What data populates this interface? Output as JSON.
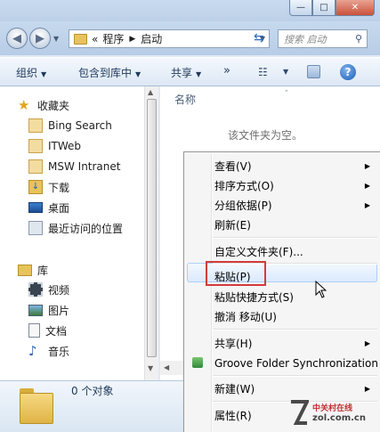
{
  "window": {
    "buttons": [
      "—",
      "□",
      "✕"
    ]
  },
  "address": {
    "prefix": "«",
    "crumbs": [
      "程序",
      "启动"
    ]
  },
  "search": {
    "placeholder": "搜索 启动"
  },
  "toolbar": {
    "organize": "组织",
    "include": "包含到库中",
    "share": "共享",
    "more": "»"
  },
  "nav": {
    "favorites_header": "收藏夹",
    "favorites": [
      "Bing Search",
      "ITWeb",
      "MSW Intranet",
      "下载",
      "桌面",
      "最近访问的位置"
    ],
    "libraries_header": "库",
    "libraries": [
      "视频",
      "图片",
      "文档",
      "音乐"
    ]
  },
  "content": {
    "column_name": "名称",
    "empty_text": "该文件夹为空。"
  },
  "details": {
    "count_text": "0 个对象"
  },
  "context_menu": {
    "items": [
      "查看(V)",
      "排序方式(O)",
      "分组依据(P)",
      "刷新(E)",
      "自定义文件夹(F)...",
      "粘贴(P)",
      "粘贴快捷方式(S)",
      "撤消 移动(U)",
      "共享(H)",
      "Groove Folder Synchronization",
      "新建(W)",
      "属性(R)"
    ],
    "highlighted": "粘贴(P)"
  },
  "watermark": {
    "title": "中关村在线",
    "url": "zol.com.cn"
  },
  "colors": {
    "accent": "#1e395b",
    "highlight_border": "#d23c3c",
    "folder": "#e8c25a"
  }
}
